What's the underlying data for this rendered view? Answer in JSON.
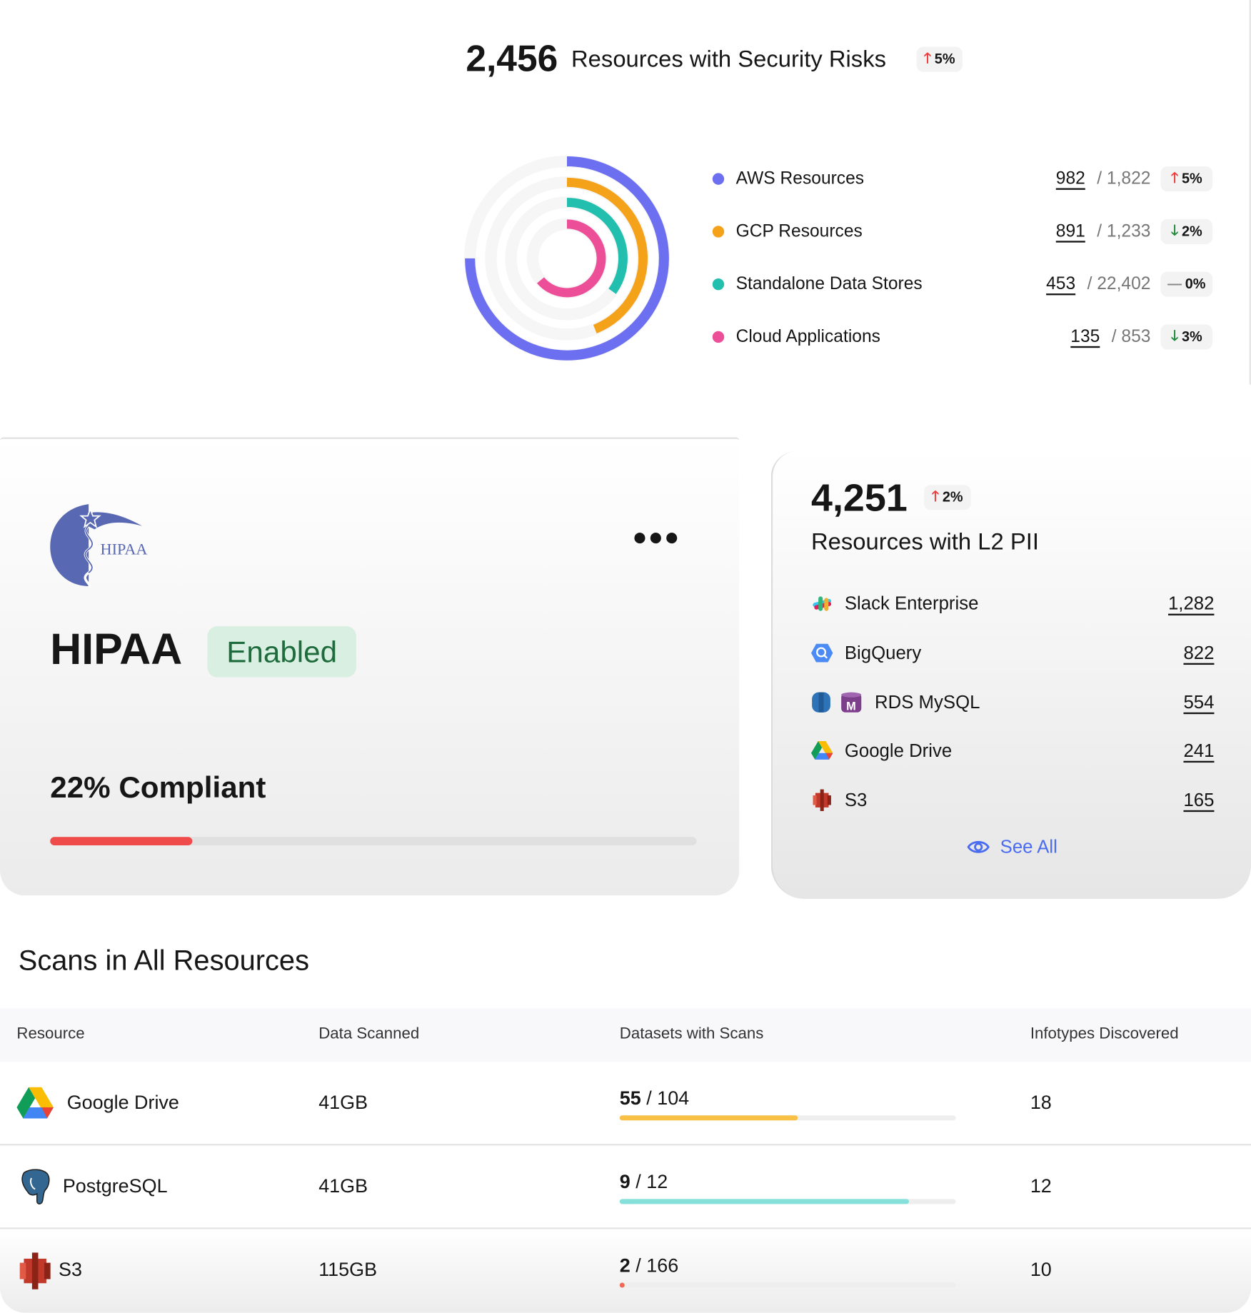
{
  "header": {
    "total": "2,456",
    "title": "Resources with Security Risks",
    "trend": {
      "direction": "up",
      "value": "5%"
    }
  },
  "chart_data": {
    "type": "radial-bar",
    "series": [
      {
        "name": "AWS Resources",
        "value": "982",
        "total": "1,822",
        "trend_direction": "up",
        "trend": "5%",
        "color": "#6c6ff0",
        "arc_fraction": 0.75
      },
      {
        "name": "GCP Resources",
        "value": "891",
        "total": "1,233",
        "trend_direction": "down",
        "trend": "2%",
        "color": "#f5a21b",
        "arc_fraction": 0.44
      },
      {
        "name": "Standalone Data Stores",
        "value": "453",
        "total": "22,402",
        "trend_direction": "flat",
        "trend": "0%",
        "color": "#22bfae",
        "arc_fraction": 0.35
      },
      {
        "name": "Cloud Applications",
        "value": "135",
        "total": "853",
        "trend_direction": "down",
        "trend": "3%",
        "color": "#ec4f98",
        "arc_fraction": 0.64
      }
    ]
  },
  "hipaa": {
    "logo_text": "HIPAA",
    "title": "HIPAA",
    "status": "Enabled",
    "compliance_label": "22% Compliant",
    "compliance_percent": 22,
    "bar_color": "#ef4b4b"
  },
  "pii": {
    "total": "4,251",
    "trend": {
      "direction": "up",
      "value": "2%"
    },
    "title": "Resources with L2 PII",
    "items": [
      {
        "name": "Slack Enterprise",
        "icon": "slack-icon",
        "value": "1,282"
      },
      {
        "name": "BigQuery",
        "icon": "bigquery-icon",
        "value": "822"
      },
      {
        "name": "RDS MySQL",
        "icon": "rds-mysql-icon",
        "value": "554"
      },
      {
        "name": "Google Drive",
        "icon": "google-drive-icon",
        "value": "241"
      },
      {
        "name": "S3",
        "icon": "s3-icon",
        "value": "165"
      }
    ],
    "see_all": "See All"
  },
  "scans": {
    "title": "Scans in All Resources",
    "columns": [
      "Resource",
      "Data Scanned",
      "Datasets with Scans",
      "Infotypes Discovered"
    ],
    "rows": [
      {
        "resource": "Google Drive",
        "icon": "google-drive-icon",
        "data_scanned": "41GB",
        "scanned": "55",
        "total": "/ 104",
        "progress": 0.53,
        "bar_color": "#f8c146",
        "infotypes": "18"
      },
      {
        "resource": "PostgreSQL",
        "icon": "postgresql-icon",
        "data_scanned": "41GB",
        "scanned": "9",
        "total": "/ 12",
        "progress": 0.86,
        "bar_color": "#84e0d9",
        "infotypes": "12"
      },
      {
        "resource": "S3",
        "icon": "s3-icon",
        "data_scanned": "115GB",
        "scanned": "2",
        "total": "/ 166",
        "progress": 0.012,
        "bar_color": "#ee6a55",
        "infotypes": "10"
      }
    ]
  }
}
